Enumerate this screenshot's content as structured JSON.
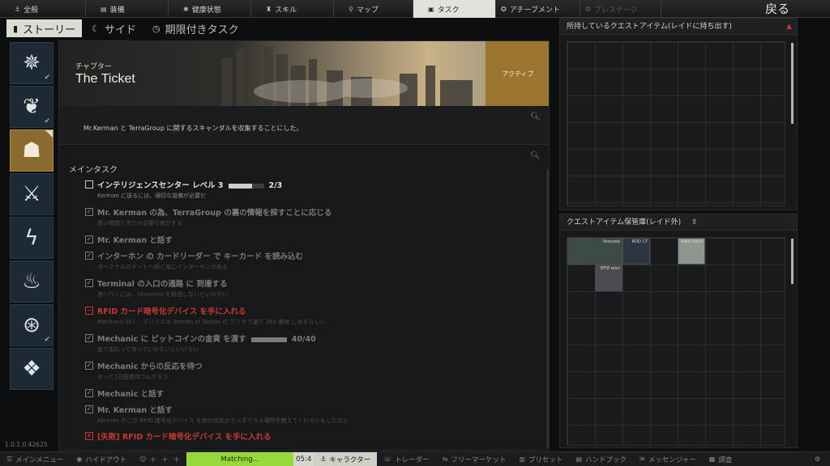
{
  "topnav": {
    "tabs": [
      {
        "label": "全般",
        "icon": "overview-icon",
        "glyph": "⚓",
        "state": "normal"
      },
      {
        "label": "装備",
        "icon": "gear-bag-icon",
        "glyph": "▤",
        "state": "normal"
      },
      {
        "label": "健康状態",
        "icon": "health-icon",
        "glyph": "✱",
        "state": "normal"
      },
      {
        "label": "スキル",
        "icon": "skills-icon",
        "glyph": "♜",
        "state": "normal"
      },
      {
        "label": "マップ",
        "icon": "map-pin-icon",
        "glyph": "⚲",
        "state": "normal"
      },
      {
        "label": "タスク",
        "icon": "task-list-icon",
        "glyph": "▣",
        "state": "active"
      },
      {
        "label": "アチーブメント",
        "icon": "achievement-icon",
        "glyph": "✪",
        "state": "normal"
      },
      {
        "label": "プレステージ",
        "icon": "prestige-icon",
        "glyph": "❂",
        "state": "disabled"
      }
    ],
    "back_label": "戻る"
  },
  "subtabs": [
    {
      "label": "ストーリー",
      "icon": "story-book-icon",
      "glyph": "▮",
      "active": true
    },
    {
      "label": "サイド",
      "icon": "side-quest-icon",
      "glyph": "☾",
      "active": false
    },
    {
      "label": "期限付きタスク",
      "icon": "timer-icon",
      "glyph": "◷",
      "active": false
    }
  ],
  "chapters": [
    {
      "icon": "compass-emblem-icon",
      "glyph": "✵",
      "completed": true,
      "active": false
    },
    {
      "icon": "flame-crest-icon",
      "glyph": "❦",
      "completed": true,
      "active": false
    },
    {
      "icon": "hat-icon",
      "glyph": "☗",
      "completed": false,
      "active": true
    },
    {
      "icon": "crossed-axes-icon",
      "glyph": "⚔",
      "completed": false,
      "active": false
    },
    {
      "icon": "lightning-icon",
      "glyph": "ϟ",
      "completed": false,
      "active": false
    },
    {
      "icon": "fire-icon",
      "glyph": "♨",
      "completed": false,
      "active": false
    },
    {
      "icon": "globe-orbit-icon",
      "glyph": "⊛",
      "completed": true,
      "active": false
    },
    {
      "icon": "pattern-emblem-icon",
      "glyph": "❖",
      "completed": false,
      "active": false
    }
  ],
  "banner": {
    "chapter_label": "チャプター",
    "chapter_title": "The Ticket",
    "status": "アクティブ"
  },
  "description": "Mr.Kerman と TerraGroup に関するスキャンダルを収集することにした。",
  "section_label": "メインタスク",
  "tasks": [
    {
      "title": "インテリジェンスセンター レベル 3",
      "sub": "Kerman に送るには、適切な設備が必要だ",
      "state": "open",
      "progress": "2/3",
      "progress_fraction": 0.67
    },
    {
      "title": "Mr. Kerman の為、TerraGroup の裏の情報を探すことに応じる",
      "sub": "長い時間と労力が必要な気がする",
      "state": "done"
    },
    {
      "title": "Mr. Kerman と話す",
      "sub": "",
      "state": "done"
    },
    {
      "title": "インターホン の カードリーダー で キーカード を読み込む",
      "sub": "ターミナルのゲートへ続く道にインターホンがある",
      "state": "done"
    },
    {
      "title": "Terminal の入口の通路 に 到達する",
      "sub": "港へ行くには、Shoreline を経由しないといけない",
      "state": "done"
    },
    {
      "title": "RFID カード暗号化デバイス を手に入れる",
      "sub": "Mechanic 曰く、デバイスは Streets of Tarkov の ヴリキで通り 368 番地 にあるらしい",
      "state": "failed-minus"
    },
    {
      "title": "Mechanic に ビットコインの金貨 を渡す",
      "sub": "金で支払って待っていかないといけない",
      "state": "done",
      "progress": "40/40",
      "progress_fraction": 1.0
    },
    {
      "title": "Mechanic からの反応を待つ",
      "sub": "きっと1日程度待つんだろう",
      "state": "done"
    },
    {
      "title": "Mechanic と話す",
      "sub": "",
      "state": "done"
    },
    {
      "title": "Mr. Kerman と話す",
      "sub": "Kerman がこの RFID 暗号化デバイス を他の何処かで入手できる場所を教えてくれるかもしれない",
      "state": "done"
    },
    {
      "title": "[失敗] RFID カード暗号化デバイス を手に入れる",
      "sub": "",
      "state": "failed"
    }
  ],
  "right_top": {
    "title": "所持しているクエストアイテム(レイドに持ち出す)",
    "warning_icon": "warning-triangle-icon"
  },
  "right_bottom": {
    "title": "クエストアイテム保管庫(レイド外)",
    "items": [
      {
        "label": "Voeyoda",
        "color": "#3b4a44"
      },
      {
        "label": "ROD CT",
        "color": "#2c3540"
      },
      {
        "label": "AWS mech",
        "color": "#8e958e"
      },
      {
        "label": "RFID encr",
        "color": "#4b4c52"
      }
    ]
  },
  "bottombar": {
    "items": [
      {
        "label": "メインメニュー",
        "icon": "menu-icon",
        "glyph": "☰"
      },
      {
        "label": "ハイドアウト",
        "icon": "hideout-icon",
        "glyph": "◉"
      },
      {
        "label": "",
        "icon": "group-icon",
        "glyph": "☺"
      },
      {
        "label": "Matching...",
        "icon": "",
        "glyph": "",
        "type": "matching"
      },
      {
        "label": "05:4",
        "icon": "",
        "glyph": "",
        "type": "timer"
      },
      {
        "label": "キャラクター",
        "icon": "character-icon",
        "glyph": "⚓",
        "type": "char"
      },
      {
        "label": "トレーダー",
        "icon": "trader-icon",
        "glyph": "☏"
      },
      {
        "label": "フリーマーケット",
        "icon": "flea-market-icon",
        "glyph": "⇆"
      },
      {
        "label": "プリセット",
        "icon": "preset-icon",
        "glyph": "▥"
      },
      {
        "label": "ハンドブック",
        "icon": "handbook-icon",
        "glyph": "▤"
      },
      {
        "label": "メッセンジャー",
        "icon": "messenger-icon",
        "glyph": "✉"
      },
      {
        "label": "調査",
        "icon": "survey-icon",
        "glyph": "▦"
      },
      {
        "label": "",
        "icon": "settings-gear-icon",
        "glyph": "⚙"
      }
    ],
    "version": "1.0.1.0.42625"
  },
  "colors": {
    "accent": "#9c7531",
    "failed": "#c83a32",
    "matching": "#97d83d"
  }
}
